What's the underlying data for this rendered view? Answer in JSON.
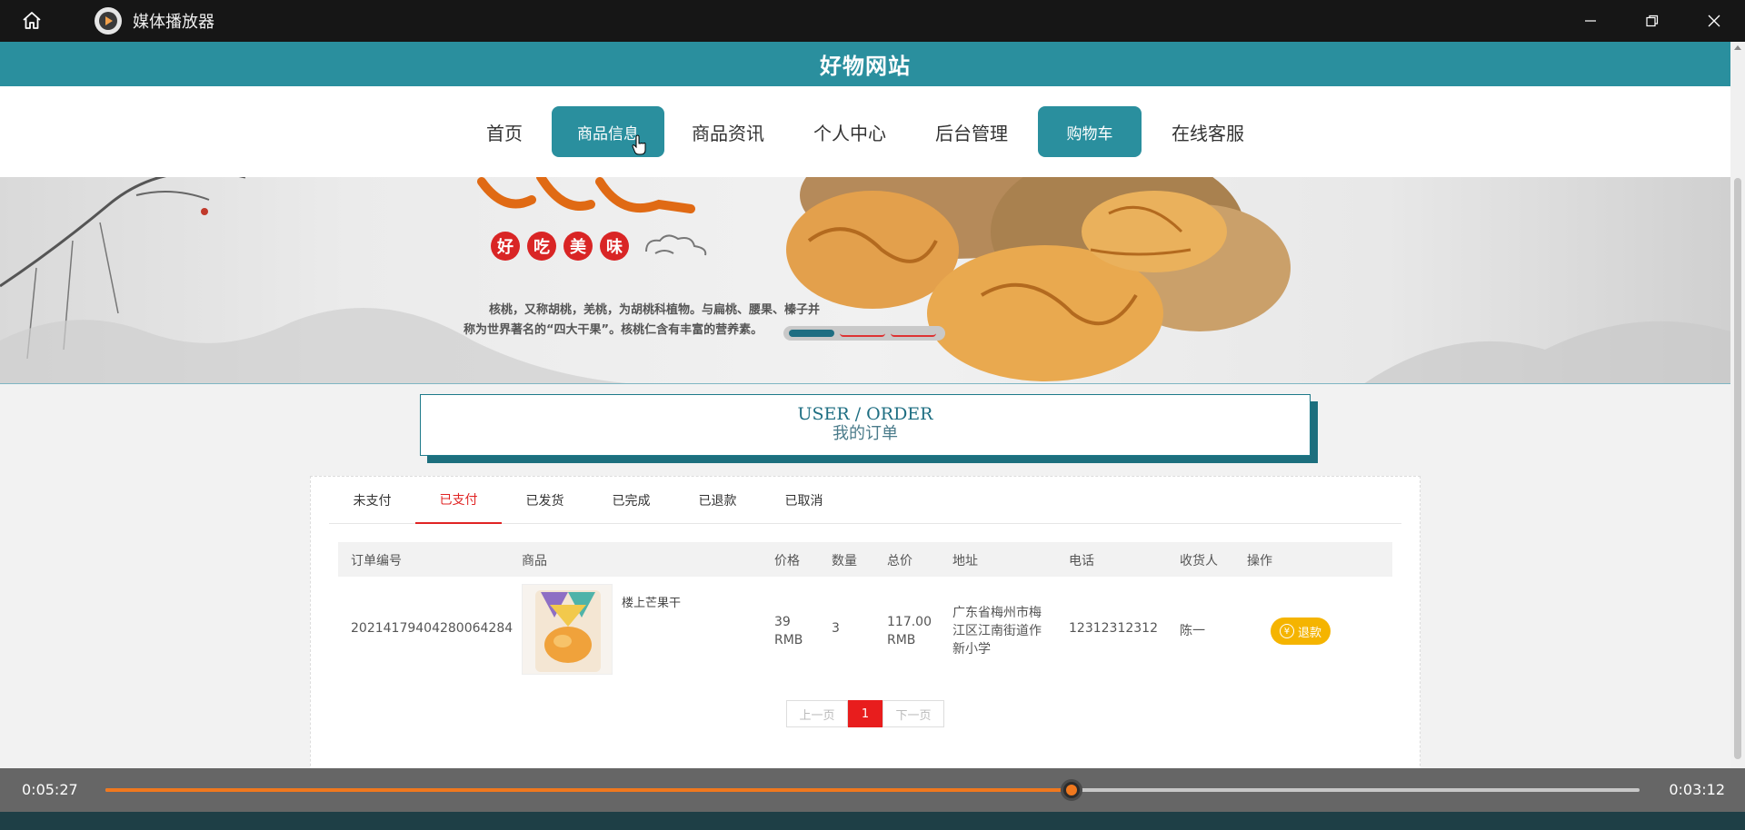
{
  "window": {
    "title": "媒体播放器",
    "icons": {
      "home": "home-icon",
      "app": "play-circle-icon",
      "minimize": "minimize-icon",
      "restore": "restore-icon",
      "close": "close-icon"
    }
  },
  "site": {
    "title": "好物网站",
    "accent": "#2a8f9e"
  },
  "nav": {
    "items": [
      "首页",
      "商品信息",
      "商品资讯",
      "个人中心",
      "后台管理",
      "购物车",
      "在线客服"
    ],
    "active": [
      "商品信息",
      "购物车"
    ]
  },
  "banner": {
    "badges": [
      "好",
      "吃",
      "美",
      "味"
    ],
    "description_line1": "核桃，又称胡桃，羌桃，为胡桃科植物。与扁桃、腰果、榛子并",
    "description_line2": "称为世界著名的“四大干果”。核桃仁含有丰富的营养素。"
  },
  "order_header": {
    "title_en": "USER / ORDER",
    "title_cn": "我的订单"
  },
  "tabs": {
    "items": [
      "未支付",
      "已支付",
      "已发货",
      "已完成",
      "已退款",
      "已取消"
    ],
    "active": "已支付"
  },
  "table": {
    "headers": [
      "订单编号",
      "商品",
      "价格",
      "数量",
      "总价",
      "地址",
      "电话",
      "收货人",
      "操作"
    ],
    "rows": [
      {
        "order_no": "20214179404280064284",
        "product": "楼上芒果干",
        "price_value": "39",
        "price_unit": "RMB",
        "quantity": "3",
        "total_value": "117.00",
        "total_unit": "RMB",
        "address_line1": "广东省梅州市梅",
        "address_line2": "江区江南街道作",
        "address_line3": "新小学",
        "phone": "12312312312",
        "receiver": "陈一",
        "action": "退款"
      }
    ]
  },
  "pager": {
    "prev": "上一页",
    "current": "1",
    "next": "下一页"
  },
  "player": {
    "elapsed": "0:05:27",
    "remaining": "0:03:12",
    "progress_fraction": 0.63,
    "progress_color": "#f0781e"
  }
}
